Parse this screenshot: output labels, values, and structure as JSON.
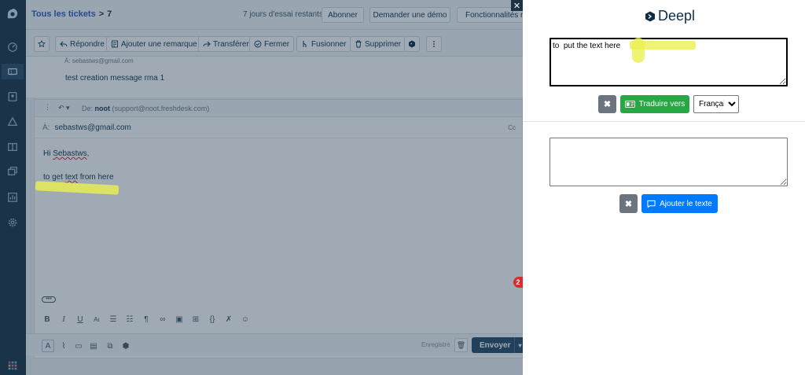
{
  "breadcrumb": {
    "label": "Tous les tickets",
    "separator": ">",
    "ticket_number": "7"
  },
  "header": {
    "trial_text": "7 jours d'essai restants",
    "subscribe_label": "Abonner",
    "demo_label": "Demander une démo",
    "features_label": "Fonctionnalités re"
  },
  "actions": {
    "reply": "Répondre",
    "add_note": "Ajouter une remarque",
    "forward": "Transférer",
    "close": "Fermer",
    "merge": "Fusionner",
    "delete": "Supprimer"
  },
  "previous_message": {
    "to": "À: sebastws@gmail.com",
    "body": "test creation message rma 1"
  },
  "reply": {
    "from_label": "De:",
    "from_name": "noot",
    "from_email": "(support@noot.freshdesk.com)",
    "to_label": "À:",
    "to_email": "sebastws@gmail.com",
    "cc_label": "Cc",
    "greeting_prefix": "Hi ",
    "greeting_name": "Sebastws",
    "greeting_suffix": ",",
    "body_prefix": "to get ",
    "body_word": "text",
    "body_suffix": " from here"
  },
  "footer": {
    "saved_label": "Enregistré",
    "send_label": "Envoyer"
  },
  "notification_count": "2",
  "deepl": {
    "brand": "Deepl",
    "source_text": "to  put the text here",
    "target_text": "",
    "translate_label": "Traduire vers",
    "language_selected": "Français",
    "add_text_label": "Ajouter le texte"
  },
  "colors": {
    "rail": "#1c3348",
    "link": "#2c5cc5",
    "green": "#28a745",
    "blue": "#007bff",
    "gray_button": "#6c757d",
    "highlight": "#ebf050"
  }
}
